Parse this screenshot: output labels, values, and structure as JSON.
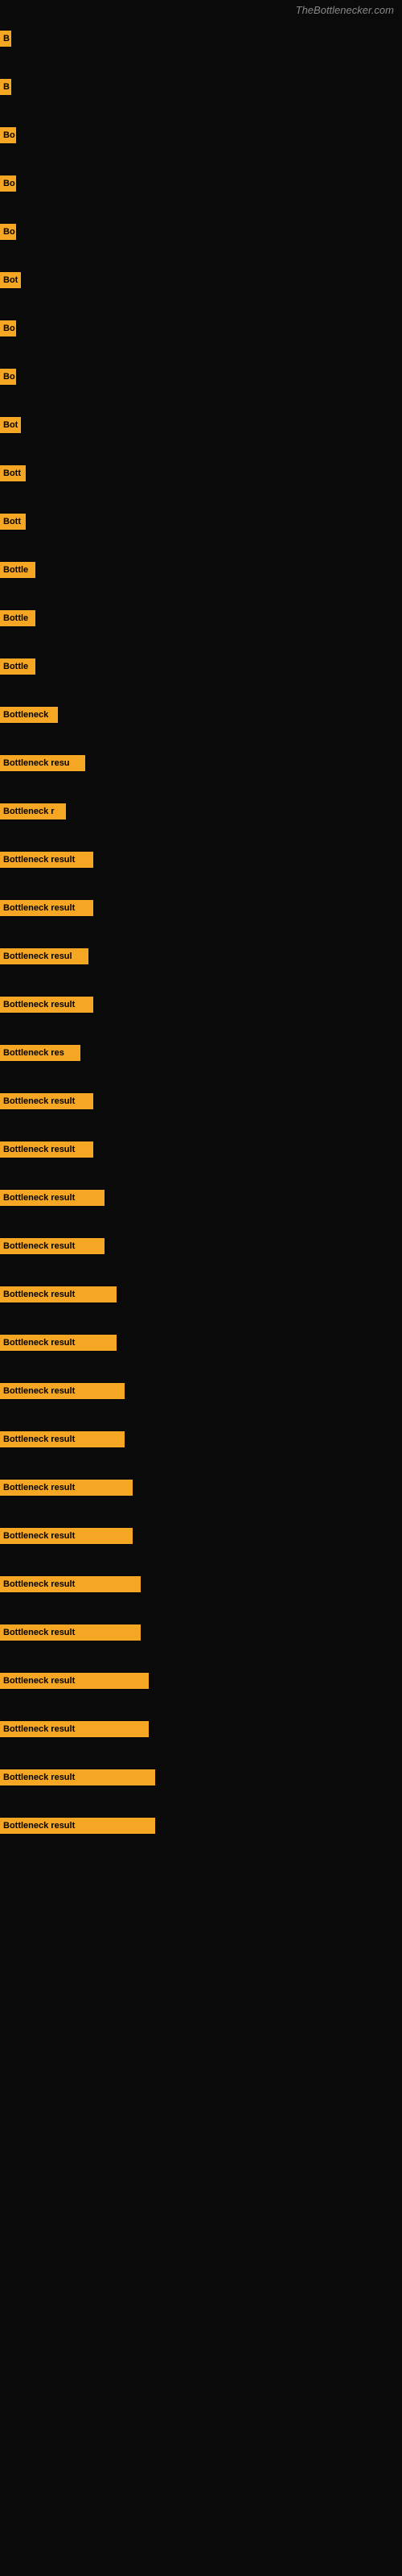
{
  "site_title": "TheBottlenecker.com",
  "rows": [
    {
      "id": 1,
      "label": "B",
      "width": 14
    },
    {
      "id": 2,
      "label": "B",
      "width": 14
    },
    {
      "id": 3,
      "label": "Bo",
      "width": 20
    },
    {
      "id": 4,
      "label": "Bo",
      "width": 20
    },
    {
      "id": 5,
      "label": "Bo",
      "width": 20
    },
    {
      "id": 6,
      "label": "Bot",
      "width": 26
    },
    {
      "id": 7,
      "label": "Bo",
      "width": 20
    },
    {
      "id": 8,
      "label": "Bo",
      "width": 20
    },
    {
      "id": 9,
      "label": "Bot",
      "width": 26
    },
    {
      "id": 10,
      "label": "Bott",
      "width": 32
    },
    {
      "id": 11,
      "label": "Bott",
      "width": 32
    },
    {
      "id": 12,
      "label": "Bottle",
      "width": 44
    },
    {
      "id": 13,
      "label": "Bottle",
      "width": 44
    },
    {
      "id": 14,
      "label": "Bottle",
      "width": 44
    },
    {
      "id": 15,
      "label": "Bottleneck",
      "width": 72
    },
    {
      "id": 16,
      "label": "Bottleneck resu",
      "width": 106
    },
    {
      "id": 17,
      "label": "Bottleneck r",
      "width": 82
    },
    {
      "id": 18,
      "label": "Bottleneck result",
      "width": 116
    },
    {
      "id": 19,
      "label": "Bottleneck result",
      "width": 116
    },
    {
      "id": 20,
      "label": "Bottleneck resul",
      "width": 110
    },
    {
      "id": 21,
      "label": "Bottleneck result",
      "width": 116
    },
    {
      "id": 22,
      "label": "Bottleneck res",
      "width": 100
    },
    {
      "id": 23,
      "label": "Bottleneck result",
      "width": 116
    },
    {
      "id": 24,
      "label": "Bottleneck result",
      "width": 116
    },
    {
      "id": 25,
      "label": "Bottleneck result",
      "width": 130
    },
    {
      "id": 26,
      "label": "Bottleneck result",
      "width": 130
    },
    {
      "id": 27,
      "label": "Bottleneck result",
      "width": 145
    },
    {
      "id": 28,
      "label": "Bottleneck result",
      "width": 145
    },
    {
      "id": 29,
      "label": "Bottleneck result",
      "width": 155
    },
    {
      "id": 30,
      "label": "Bottleneck result",
      "width": 155
    },
    {
      "id": 31,
      "label": "Bottleneck result",
      "width": 165
    },
    {
      "id": 32,
      "label": "Bottleneck result",
      "width": 165
    },
    {
      "id": 33,
      "label": "Bottleneck result",
      "width": 175
    },
    {
      "id": 34,
      "label": "Bottleneck result",
      "width": 175
    },
    {
      "id": 35,
      "label": "Bottleneck result",
      "width": 185
    },
    {
      "id": 36,
      "label": "Bottleneck result",
      "width": 185
    },
    {
      "id": 37,
      "label": "Bottleneck result",
      "width": 193
    },
    {
      "id": 38,
      "label": "Bottleneck result",
      "width": 193
    }
  ]
}
